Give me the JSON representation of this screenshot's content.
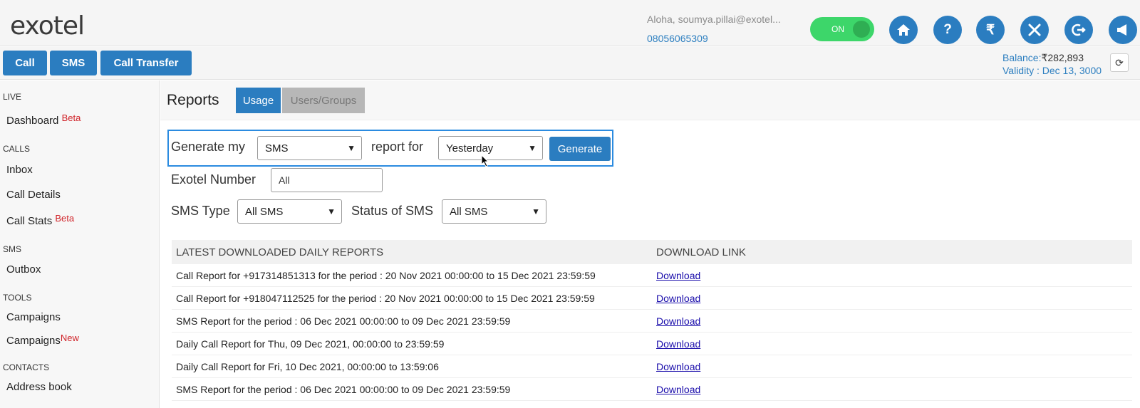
{
  "header": {
    "logo_text": "exotel",
    "greeting": "Aloha, soumya.pillai@exotel...",
    "phone": "08056065309",
    "toggle_label": "ON",
    "icons": [
      "home-icon",
      "help-icon",
      "rupee-icon",
      "tools-icon",
      "logout-icon",
      "announcement-icon"
    ],
    "icon_glyphs": [
      "⌂",
      "?",
      "₹",
      "✕",
      "⇥",
      "📢"
    ]
  },
  "topbar": {
    "buttons": [
      "Call",
      "SMS",
      "Call Transfer"
    ],
    "balance_label": "Balance:",
    "balance_value": "₹282,893",
    "validity": "Validity : Dec 13, 3000"
  },
  "sidebar": {
    "live": "LIVE",
    "dashboard": "Dashboard",
    "dashboard_badge": "Beta",
    "calls": "CALLS",
    "inbox": "Inbox",
    "call_details": "Call Details",
    "call_stats": "Call Stats",
    "call_stats_badge": "Beta",
    "sms": "SMS",
    "outbox": "Outbox",
    "tools": "TOOLS",
    "campaigns": "Campaigns",
    "campaigns2": "Campaigns",
    "campaigns2_badge": "New",
    "contacts": "CONTACTS",
    "address_book": "Address book"
  },
  "main": {
    "title": "Reports",
    "tab_usage": "Usage",
    "tab_users": "Users/Groups",
    "generate_my": "Generate my",
    "report_type": "SMS",
    "report_for": "report for",
    "period": "Yesterday",
    "generate_btn": "Generate",
    "exotel_number_label": "Exotel Number",
    "exotel_number_value": "All",
    "sms_type_label": "SMS Type",
    "sms_type_value": "All SMS",
    "status_label": "Status of SMS",
    "status_value": "All SMS"
  },
  "table": {
    "col1": "LATEST DOWNLOADED DAILY REPORTS",
    "col2": "DOWNLOAD LINK",
    "rows": [
      {
        "report": "Call Report for +917314851313 for the period : 20 Nov 2021 00:00:00 to 15 Dec 2021 23:59:59",
        "link": "Download"
      },
      {
        "report": "Call Report for +918047112525 for the period : 20 Nov 2021 00:00:00 to 15 Dec 2021 23:59:59",
        "link": "Download"
      },
      {
        "report": "SMS Report for the period : 06 Dec 2021 00:00:00 to 09 Dec 2021 23:59:59",
        "link": "Download"
      },
      {
        "report": "Daily Call Report for Thu, 09 Dec 2021, 00:00:00 to 23:59:59",
        "link": "Download"
      },
      {
        "report": "Daily Call Report for Fri, 10 Dec 2021, 00:00:00 to 13:59:06",
        "link": "Download"
      },
      {
        "report": "SMS Report for the period : 06 Dec 2021 00:00:00 to 09 Dec 2021 23:59:59",
        "link": "Download"
      }
    ]
  }
}
